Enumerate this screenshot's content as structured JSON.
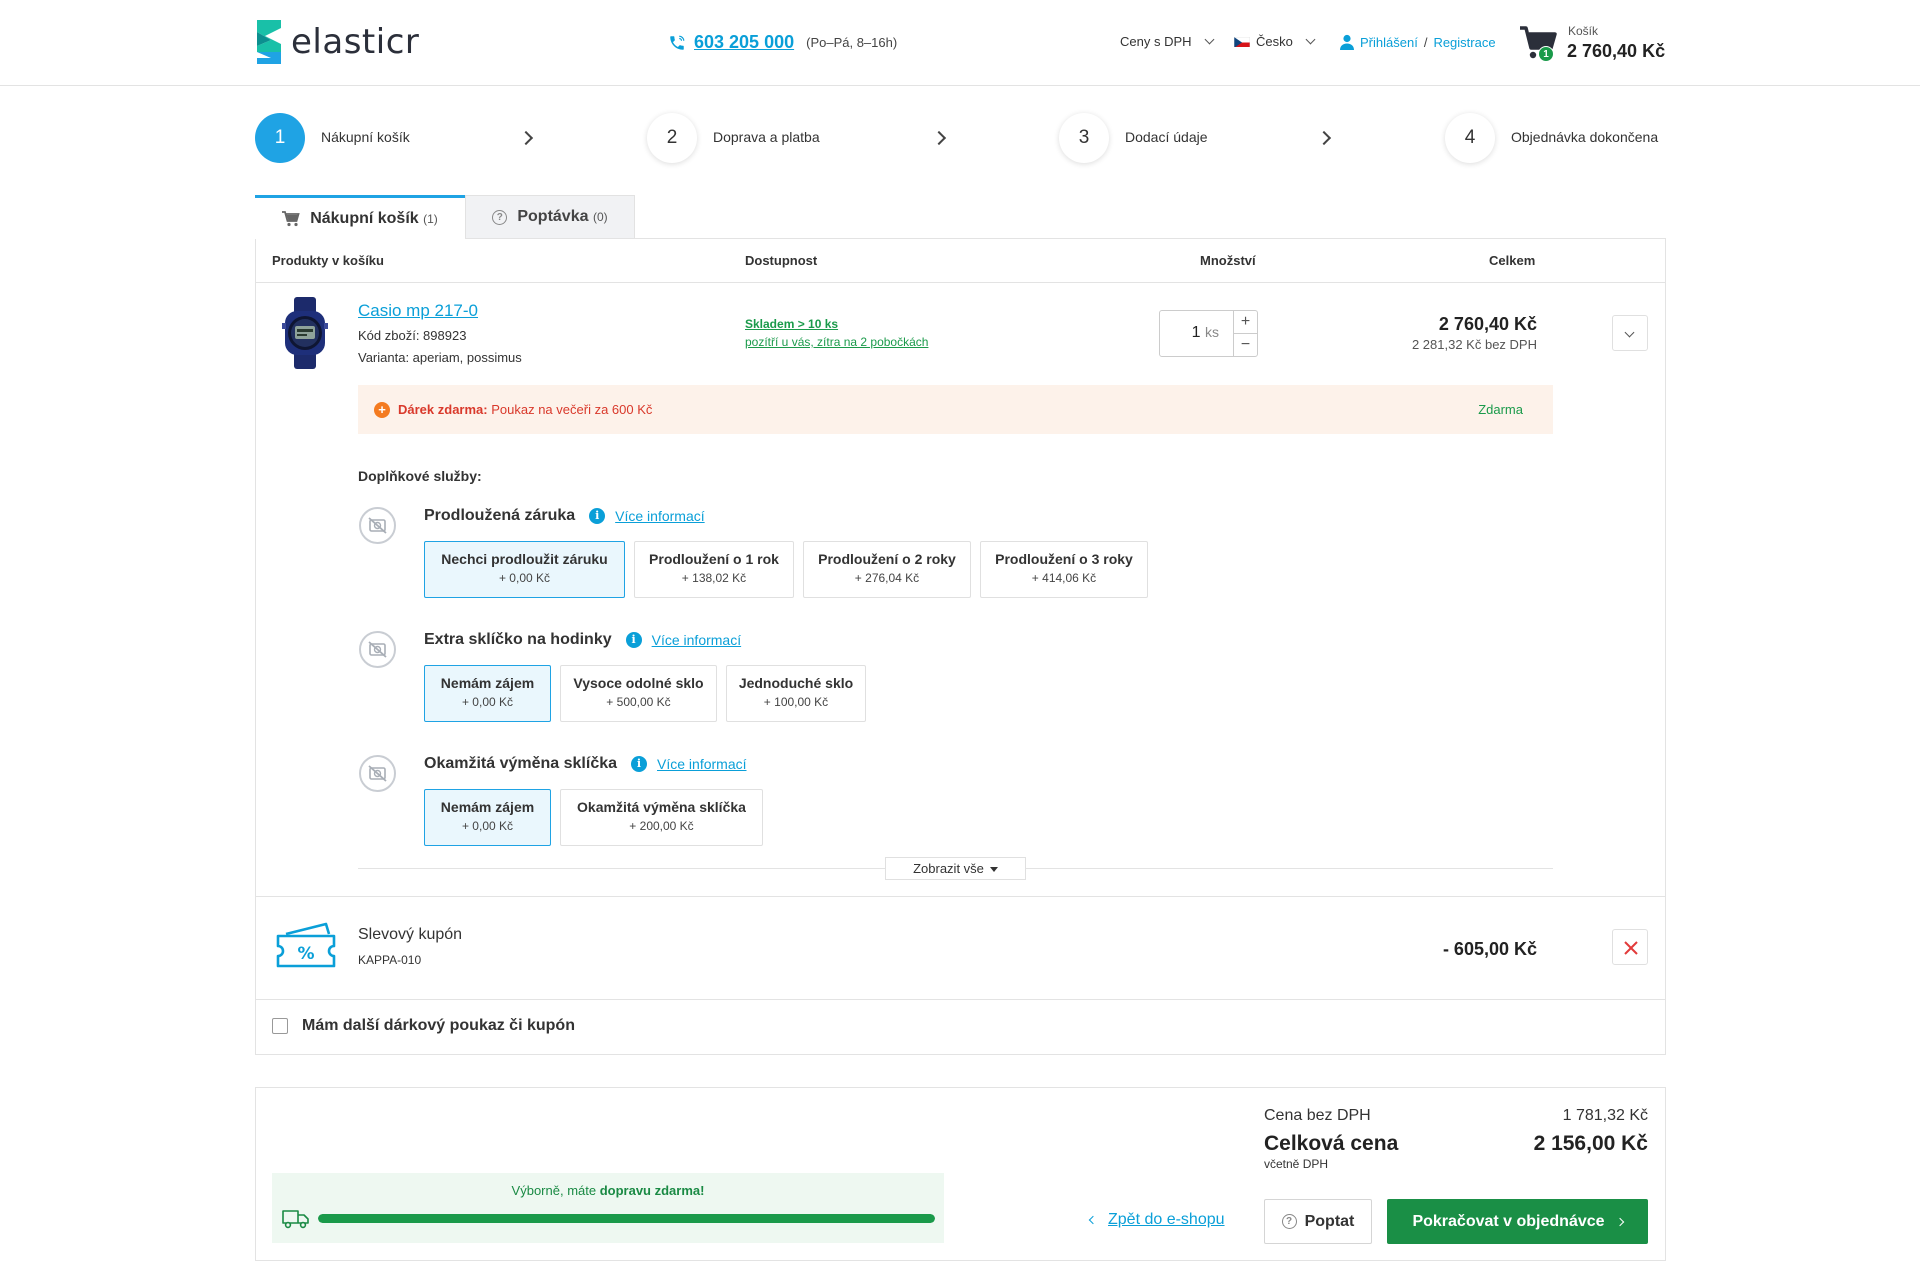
{
  "header": {
    "logo_text": "elasticr",
    "phone": "603 205 000",
    "phone_hours": "(Po–Pá, 8–16h)",
    "price_mode": "Ceny s DPH",
    "country": "Česko",
    "login": "Přihlášení",
    "separator": "/",
    "register": "Registrace",
    "cart_label": "Košík",
    "cart_total": "2 760,40 Kč",
    "cart_count": "1"
  },
  "steps": [
    {
      "num": "1",
      "label": "Nákupní košík"
    },
    {
      "num": "2",
      "label": "Doprava a platba"
    },
    {
      "num": "3",
      "label": "Dodací údaje"
    },
    {
      "num": "4",
      "label": "Objednávka dokončena"
    }
  ],
  "tabs": [
    {
      "label": "Nákupní košík",
      "count": "(1)"
    },
    {
      "label": "Poptávka",
      "count": "(0)"
    }
  ],
  "columns": {
    "products": "Produkty v košíku",
    "availability": "Dostupnost",
    "quantity": "Množství",
    "total": "Celkem"
  },
  "product": {
    "name": "Casio mp 217-0",
    "code": "Kód zboží: 898923",
    "variant": "Varianta: aperiam, possimus",
    "stock": "Skladem > 10 ks",
    "stock_note": "pozítří u vás, zítra na 2 pobočkách",
    "qty": "1",
    "qty_unit": "ks",
    "price": "2 760,40 Kč",
    "price_net": "2 281,32 Kč bez DPH"
  },
  "gift": {
    "label": "Dárek zdarma:",
    "text": "Poukaz na večeři za 600 Kč",
    "price": "Zdarma"
  },
  "services": {
    "heading": "Doplňkové služby:",
    "more_info": "Více informací",
    "groups": [
      {
        "title": "Prodloužená záruka",
        "options": [
          {
            "name": "Nechci prodloužit záruku",
            "price": "+ 0,00 Kč"
          },
          {
            "name": "Prodloužení o 1 rok",
            "price": "+ 138,02 Kč"
          },
          {
            "name": "Prodloužení o 2 roky",
            "price": "+ 276,04 Kč"
          },
          {
            "name": "Prodloužení o 3 roky",
            "price": "+ 414,06 Kč"
          }
        ]
      },
      {
        "title": "Extra sklíčko na hodinky",
        "options": [
          {
            "name": "Nemám zájem",
            "price": "+ 0,00 Kč"
          },
          {
            "name": "Vysoce odolné sklo",
            "price": "+ 500,00 Kč"
          },
          {
            "name": "Jednoduché sklo",
            "price": "+ 100,00 Kč"
          }
        ]
      },
      {
        "title": "Okamžitá výměna sklíčka",
        "options": [
          {
            "name": "Nemám zájem",
            "price": "+ 0,00 Kč"
          },
          {
            "name": "Okamžitá výměna sklíčka",
            "price": "+ 200,00 Kč"
          }
        ]
      }
    ],
    "show_all": "Zobrazit vše"
  },
  "coupon": {
    "title": "Slevový kupón",
    "code": "KAPPA-010",
    "amount": "- 605,00 Kč"
  },
  "other_voucher": "Mám další dárkový poukaz či kupón",
  "summary": {
    "shipping_msg_pre": "Výborně, máte ",
    "shipping_msg_bold": "dopravu zdarma!",
    "shipping_progress": 1.0,
    "net_label": "Cena bez DPH",
    "net_value": "1 781,32 Kč",
    "total_label": "Celková cena",
    "total_value": "2 156,00 Kč",
    "total_note": "včetně DPH",
    "back": "Zpět do e-shopu",
    "ask": "Poptat",
    "continue": "Pokračovat v objednávce"
  },
  "colors": {
    "accent": "#1fa3e4",
    "link": "#0a9fd8",
    "success": "#1a9a4a",
    "gift_bg": "#fdf2ea",
    "danger": "#d9392b"
  }
}
